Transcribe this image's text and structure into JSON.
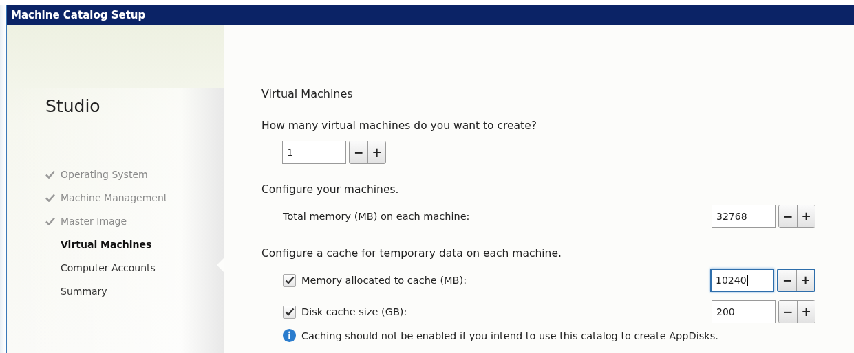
{
  "window": {
    "title": "Machine Catalog Setup"
  },
  "sidebar": {
    "heading": "Studio",
    "steps": [
      {
        "label": "Operating System",
        "completed": true,
        "selected": false
      },
      {
        "label": "Machine Management",
        "completed": true,
        "selected": false
      },
      {
        "label": "Master Image",
        "completed": true,
        "selected": false
      },
      {
        "label": "Virtual Machines",
        "completed": false,
        "selected": true
      },
      {
        "label": "Computer Accounts",
        "completed": false,
        "selected": false
      },
      {
        "label": "Summary",
        "completed": false,
        "selected": false
      }
    ]
  },
  "content": {
    "title": "Virtual Machines",
    "sections": [
      {
        "heading": "How many virtual machines do you want to create?",
        "rows": [
          {
            "kind": "plain",
            "value": "1",
            "focused": false,
            "minus": "−",
            "plus": "+"
          }
        ]
      },
      {
        "heading": "Configure your machines.",
        "rows": [
          {
            "kind": "labeled",
            "label": "Total memory (MB) on each machine:",
            "value": "32768",
            "focused": false,
            "minus": "−",
            "plus": "+"
          }
        ]
      },
      {
        "heading": "Configure a cache for temporary data on each machine.",
        "rows": [
          {
            "kind": "checkbox",
            "label": "Memory allocated to cache (MB):",
            "checked": true,
            "value": "10240",
            "focused": true,
            "minus": "−",
            "plus": "+"
          },
          {
            "kind": "checkbox",
            "label": "Disk cache size (GB):",
            "checked": true,
            "value": "200",
            "focused": false,
            "minus": "−",
            "plus": "+"
          }
        ]
      }
    ],
    "note": "Caching should not be enabled if you intend to use this catalog to create AppDisks."
  }
}
